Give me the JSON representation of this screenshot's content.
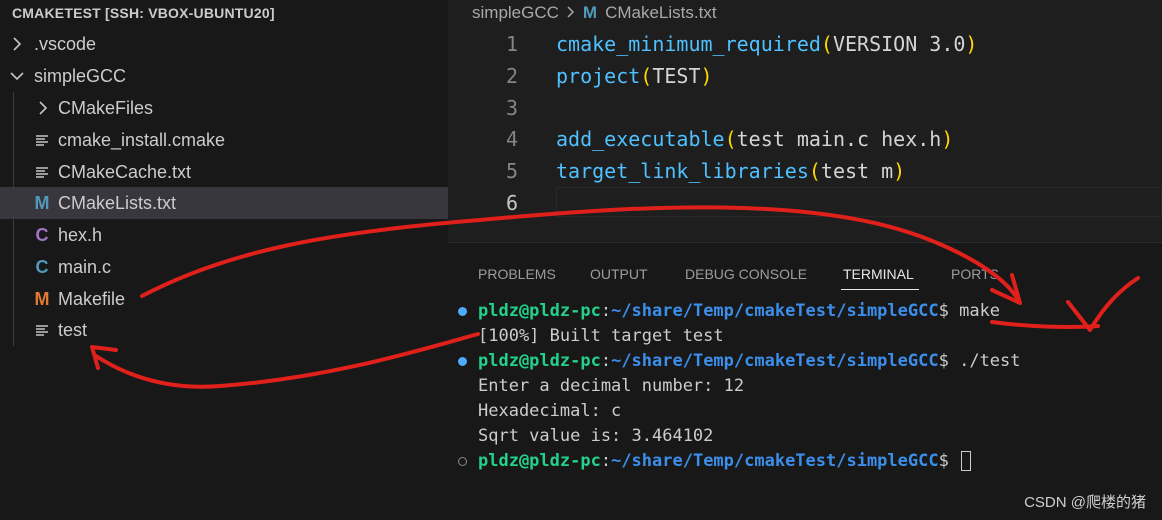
{
  "explorer": {
    "title": "CMAKETEST [SSH: VBOX-UBUNTU20]",
    "items": [
      {
        "label": ".vscode",
        "icon": "chevron-right-icon"
      },
      {
        "label": "simpleGCC",
        "icon": "chevron-down-icon"
      },
      {
        "label": "CMakeFiles",
        "icon": "chevron-right-icon"
      },
      {
        "label": "cmake_install.cmake",
        "icon": "lines-file-icon"
      },
      {
        "label": "CMakeCache.txt",
        "icon": "lines-file-icon"
      },
      {
        "label": "CMakeLists.txt",
        "icon": "cmake-m-icon",
        "glyph": "M"
      },
      {
        "label": "hex.h",
        "icon": "c-header-icon",
        "glyph": "C"
      },
      {
        "label": "main.c",
        "icon": "c-source-icon",
        "glyph": "C"
      },
      {
        "label": "Makefile",
        "icon": "makefile-m-icon",
        "glyph": "M"
      },
      {
        "label": "test",
        "icon": "lines-file-icon"
      }
    ],
    "selected": "CMakeLists.txt"
  },
  "editor": {
    "breadcrumb": {
      "folder": "simpleGCC",
      "file_glyph": "M",
      "file": "CMakeLists.txt"
    },
    "lines": [
      {
        "num": "1",
        "fn": "cmake_minimum_required",
        "args": "VERSION 3.0"
      },
      {
        "num": "2",
        "fn": "project",
        "args": "TEST"
      },
      {
        "num": "3",
        "fn": "",
        "args": ""
      },
      {
        "num": "4",
        "fn": "add_executable",
        "args": "test main.c hex.h"
      },
      {
        "num": "5",
        "fn": "target_link_libraries",
        "args": "test m"
      },
      {
        "num": "6",
        "fn": "",
        "args": ""
      }
    ]
  },
  "panel": {
    "tabs": [
      "PROBLEMS",
      "OUTPUT",
      "DEBUG CONSOLE",
      "TERMINAL",
      "PORTS"
    ],
    "active_tab": "TERMINAL",
    "terminal": {
      "user": "pldz@pldz-pc",
      "path": "~/share/Temp/cmakeTest/simpleGCC",
      "prompt_suffix": "$",
      "cmd1": "make",
      "out1": "[100%] Built target test",
      "cmd2": "./test",
      "out2": "Enter a decimal number: 12",
      "out3": "Hexadecimal: c",
      "out4": "Sqrt value is: 3.464102"
    }
  },
  "watermark": "CSDN @爬楼的猪",
  "colors": {
    "annotation": "#e0201b",
    "fn": "#4fc1ff",
    "paren": "#ffd700",
    "prompt_user": "#23d18b",
    "prompt_path": "#3b8eea"
  }
}
